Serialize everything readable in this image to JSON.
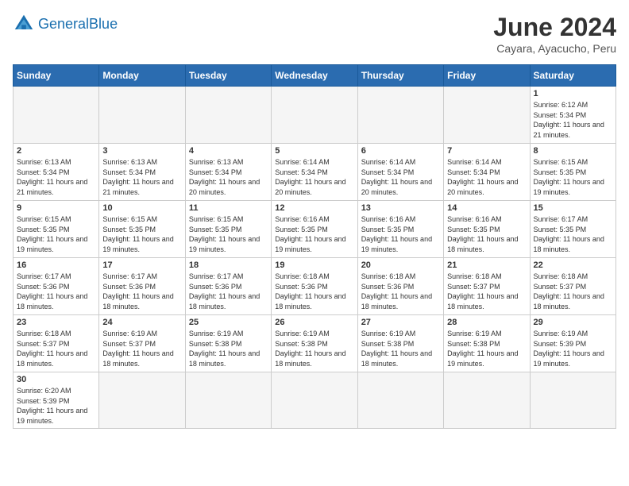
{
  "header": {
    "logo_general": "General",
    "logo_blue": "Blue",
    "month_year": "June 2024",
    "location": "Cayara, Ayacucho, Peru"
  },
  "weekdays": [
    "Sunday",
    "Monday",
    "Tuesday",
    "Wednesday",
    "Thursday",
    "Friday",
    "Saturday"
  ],
  "weeks": [
    [
      {
        "day": "",
        "info": ""
      },
      {
        "day": "",
        "info": ""
      },
      {
        "day": "",
        "info": ""
      },
      {
        "day": "",
        "info": ""
      },
      {
        "day": "",
        "info": ""
      },
      {
        "day": "",
        "info": ""
      },
      {
        "day": "1",
        "info": "Sunrise: 6:12 AM\nSunset: 5:34 PM\nDaylight: 11 hours and 21 minutes."
      }
    ],
    [
      {
        "day": "2",
        "info": "Sunrise: 6:13 AM\nSunset: 5:34 PM\nDaylight: 11 hours and 21 minutes."
      },
      {
        "day": "3",
        "info": "Sunrise: 6:13 AM\nSunset: 5:34 PM\nDaylight: 11 hours and 21 minutes."
      },
      {
        "day": "4",
        "info": "Sunrise: 6:13 AM\nSunset: 5:34 PM\nDaylight: 11 hours and 20 minutes."
      },
      {
        "day": "5",
        "info": "Sunrise: 6:14 AM\nSunset: 5:34 PM\nDaylight: 11 hours and 20 minutes."
      },
      {
        "day": "6",
        "info": "Sunrise: 6:14 AM\nSunset: 5:34 PM\nDaylight: 11 hours and 20 minutes."
      },
      {
        "day": "7",
        "info": "Sunrise: 6:14 AM\nSunset: 5:34 PM\nDaylight: 11 hours and 20 minutes."
      },
      {
        "day": "8",
        "info": "Sunrise: 6:15 AM\nSunset: 5:35 PM\nDaylight: 11 hours and 19 minutes."
      }
    ],
    [
      {
        "day": "9",
        "info": "Sunrise: 6:15 AM\nSunset: 5:35 PM\nDaylight: 11 hours and 19 minutes."
      },
      {
        "day": "10",
        "info": "Sunrise: 6:15 AM\nSunset: 5:35 PM\nDaylight: 11 hours and 19 minutes."
      },
      {
        "day": "11",
        "info": "Sunrise: 6:15 AM\nSunset: 5:35 PM\nDaylight: 11 hours and 19 minutes."
      },
      {
        "day": "12",
        "info": "Sunrise: 6:16 AM\nSunset: 5:35 PM\nDaylight: 11 hours and 19 minutes."
      },
      {
        "day": "13",
        "info": "Sunrise: 6:16 AM\nSunset: 5:35 PM\nDaylight: 11 hours and 19 minutes."
      },
      {
        "day": "14",
        "info": "Sunrise: 6:16 AM\nSunset: 5:35 PM\nDaylight: 11 hours and 18 minutes."
      },
      {
        "day": "15",
        "info": "Sunrise: 6:17 AM\nSunset: 5:35 PM\nDaylight: 11 hours and 18 minutes."
      }
    ],
    [
      {
        "day": "16",
        "info": "Sunrise: 6:17 AM\nSunset: 5:36 PM\nDaylight: 11 hours and 18 minutes."
      },
      {
        "day": "17",
        "info": "Sunrise: 6:17 AM\nSunset: 5:36 PM\nDaylight: 11 hours and 18 minutes."
      },
      {
        "day": "18",
        "info": "Sunrise: 6:17 AM\nSunset: 5:36 PM\nDaylight: 11 hours and 18 minutes."
      },
      {
        "day": "19",
        "info": "Sunrise: 6:18 AM\nSunset: 5:36 PM\nDaylight: 11 hours and 18 minutes."
      },
      {
        "day": "20",
        "info": "Sunrise: 6:18 AM\nSunset: 5:36 PM\nDaylight: 11 hours and 18 minutes."
      },
      {
        "day": "21",
        "info": "Sunrise: 6:18 AM\nSunset: 5:37 PM\nDaylight: 11 hours and 18 minutes."
      },
      {
        "day": "22",
        "info": "Sunrise: 6:18 AM\nSunset: 5:37 PM\nDaylight: 11 hours and 18 minutes."
      }
    ],
    [
      {
        "day": "23",
        "info": "Sunrise: 6:18 AM\nSunset: 5:37 PM\nDaylight: 11 hours and 18 minutes."
      },
      {
        "day": "24",
        "info": "Sunrise: 6:19 AM\nSunset: 5:37 PM\nDaylight: 11 hours and 18 minutes."
      },
      {
        "day": "25",
        "info": "Sunrise: 6:19 AM\nSunset: 5:38 PM\nDaylight: 11 hours and 18 minutes."
      },
      {
        "day": "26",
        "info": "Sunrise: 6:19 AM\nSunset: 5:38 PM\nDaylight: 11 hours and 18 minutes."
      },
      {
        "day": "27",
        "info": "Sunrise: 6:19 AM\nSunset: 5:38 PM\nDaylight: 11 hours and 18 minutes."
      },
      {
        "day": "28",
        "info": "Sunrise: 6:19 AM\nSunset: 5:38 PM\nDaylight: 11 hours and 19 minutes."
      },
      {
        "day": "29",
        "info": "Sunrise: 6:19 AM\nSunset: 5:39 PM\nDaylight: 11 hours and 19 minutes."
      }
    ],
    [
      {
        "day": "30",
        "info": "Sunrise: 6:20 AM\nSunset: 5:39 PM\nDaylight: 11 hours and 19 minutes."
      },
      {
        "day": "",
        "info": ""
      },
      {
        "day": "",
        "info": ""
      },
      {
        "day": "",
        "info": ""
      },
      {
        "day": "",
        "info": ""
      },
      {
        "day": "",
        "info": ""
      },
      {
        "day": "",
        "info": ""
      }
    ]
  ]
}
